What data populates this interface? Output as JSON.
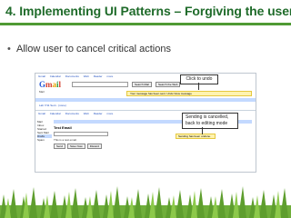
{
  "slide": {
    "title": "4. Implementing UI Patterns – Forgiving the user",
    "bullet": "Allow user to cancel critical actions"
  },
  "screenshot_top": {
    "gbar_links": [
      "Gmail",
      "Calendar",
      "Documents",
      "Web",
      "Reader",
      "more"
    ],
    "search_button": "Search Mail",
    "search_web_button": "Search the Web",
    "notice": "Your message has been sent. Undo View message",
    "mail_label": "Mail",
    "row_text": "Lab 7/11 Sent - (none)"
  },
  "screenshot_bottom": {
    "gbar_links": [
      "Gmail",
      "Calendar",
      "Documents",
      "Web",
      "Reader",
      "more"
    ],
    "nav": [
      "Mail",
      "Inbox",
      "Starred",
      "Sent Mail",
      "Drafts",
      "Spam"
    ],
    "subject": "Test Email",
    "body": "This is a test email.",
    "buttons": [
      "Send",
      "Save Now",
      "Discard"
    ],
    "notice": "Sending has been undone."
  },
  "callouts": {
    "undo": "Click to undo",
    "sending_line1": "Sending is cancelled,",
    "sending_line2": "back to editing mode"
  },
  "colors": {
    "title": "#1f6b2a",
    "rule": "#4f9a34",
    "notice": "#fff3b0",
    "gmail_blue": "#c3d9ff"
  }
}
